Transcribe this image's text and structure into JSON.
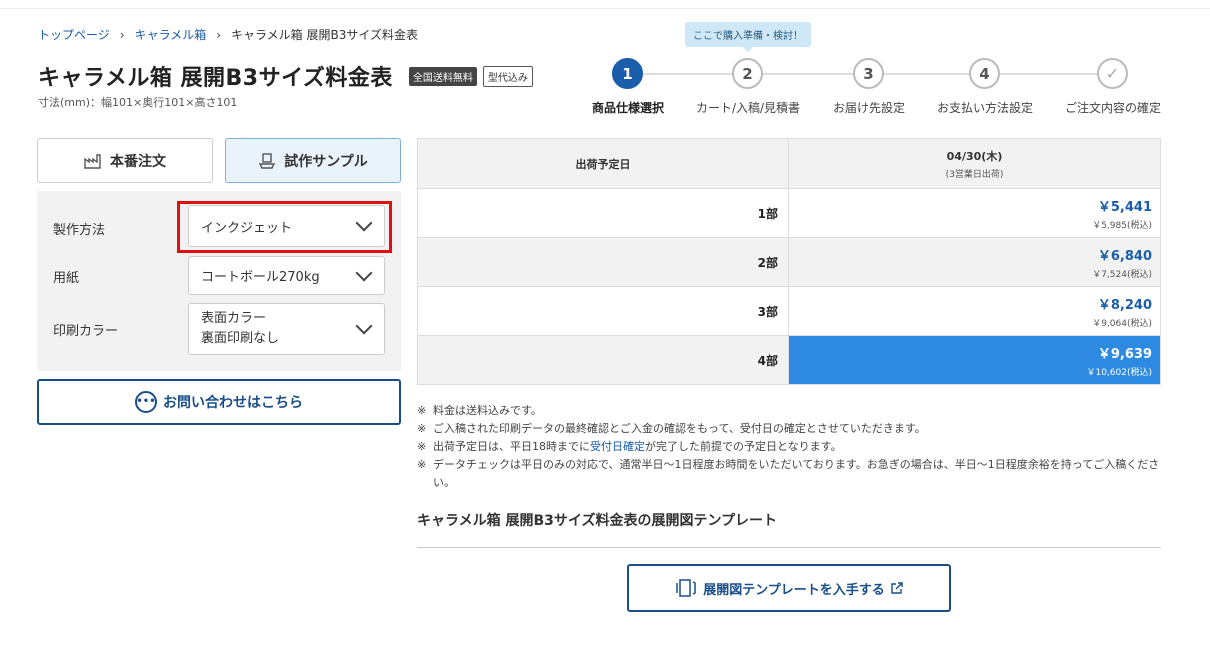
{
  "breadcrumb": {
    "items": [
      "トップページ",
      "キャラメル箱"
    ],
    "current": "キャラメル箱 展開B3サイズ料金表",
    "sep": "›"
  },
  "page": {
    "title": "キャラメル箱 展開B3サイズ料金表",
    "badge_shipping": "全国送料無料",
    "badge_mold": "型代込み",
    "dimensions": "寸法(mm)：幅101×奥行101×高さ101"
  },
  "steps": {
    "tooltip": "ここで購入準備・検討！",
    "items": [
      {
        "num": "1",
        "label": "商品仕様選択",
        "active": true
      },
      {
        "num": "2",
        "label": "カート/入稿/見積書",
        "active": false
      },
      {
        "num": "3",
        "label": "お届け先設定",
        "active": false
      },
      {
        "num": "4",
        "label": "お支払い方法設定",
        "active": false
      },
      {
        "num": "✓",
        "label": "ご注文内容の確定",
        "active": false
      }
    ]
  },
  "tabs": {
    "production": "本番注文",
    "sample": "試作サンプル"
  },
  "options": {
    "method_label": "製作方法",
    "method_value": "インクジェット",
    "paper_label": "用紙",
    "paper_value": "コートボール270kg",
    "color_label": "印刷カラー",
    "color_value_1": "表面カラー",
    "color_value_2": "裏面印刷なし"
  },
  "contact": {
    "label": "お問い合わせはこちら",
    "icon": "•••"
  },
  "price_table": {
    "header_left": "出荷予定日",
    "header_date": "04/30(木)",
    "header_sub": "(3営業日出荷)",
    "rows": [
      {
        "qty": "1部",
        "price": "￥5,441",
        "tax": "￥5,985(税込)"
      },
      {
        "qty": "2部",
        "price": "￥6,840",
        "tax": "￥7,524(税込)"
      },
      {
        "qty": "3部",
        "price": "￥8,240",
        "tax": "￥9,064(税込)"
      },
      {
        "qty": "4部",
        "price": "￥9,639",
        "tax": "￥10,602(税込)"
      }
    ]
  },
  "notes": {
    "n1": "料金は送料込みです。",
    "n2": "ご入稿された印刷データの最終確認とご入金の確認をもって、受付日の確定とさせていただきます。",
    "n3_a": "出荷予定日は、平日18時までに",
    "n3_link": "受付日確定",
    "n3_b": "が完了した前提での予定日となります。",
    "n4": "データチェックは平日のみの対応で、通常半日〜1日程度お時間をいただいております。お急ぎの場合は、半日〜1日程度余裕を持ってご入稿ください。"
  },
  "template": {
    "heading": "キャラメル箱 展開B3サイズ料金表の展開図テンプレート",
    "button": "展開図テンプレートを入手する"
  },
  "colors": {
    "brand": "#1a5dab",
    "selected": "#2e8ae0",
    "highlight": "#e01010"
  }
}
